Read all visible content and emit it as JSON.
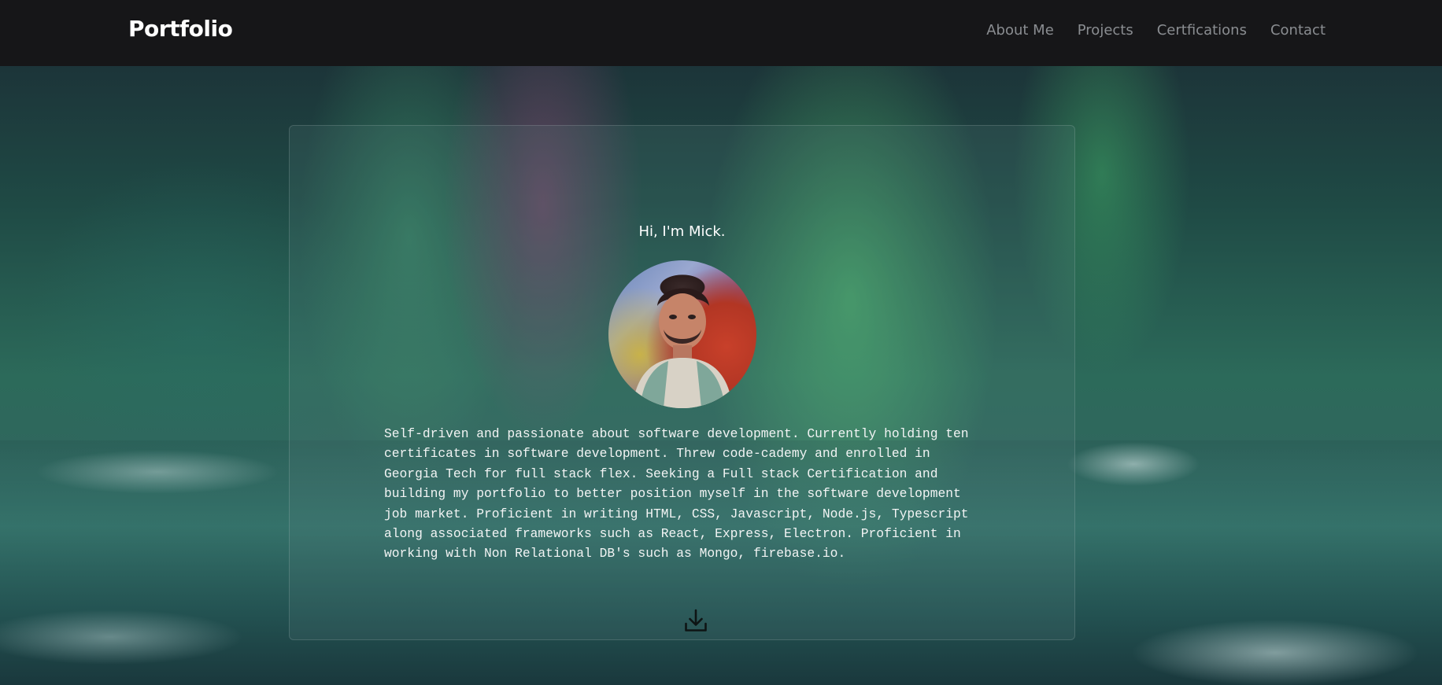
{
  "header": {
    "brand": "Portfolio",
    "nav": [
      {
        "label": "About Me"
      },
      {
        "label": "Projects"
      },
      {
        "label": "Certfications"
      },
      {
        "label": "Contact"
      }
    ]
  },
  "hero": {
    "greeting": "Hi, I'm Mick.",
    "avatar_alt": "profile-photo",
    "bio": "Self-driven and passionate about software development. Currently holding ten certificates in software development. Threw code-cademy and enrolled in Georgia Tech for full stack flex. Seeking a Full stack Certification and building my portfolio to better position myself in the software development job market. Proficient in writing HTML, CSS, Javascript, Node.js, Typescript along associated frameworks such as React, Express, Electron. Proficient in working with Non Relational DB's such as Mongo, firebase.io.",
    "download_icon": "download-icon"
  },
  "colors": {
    "navbar": "#161618",
    "nav_link": "#8a8d91",
    "brand": "#ffffff",
    "text": "#f2f4f4"
  }
}
